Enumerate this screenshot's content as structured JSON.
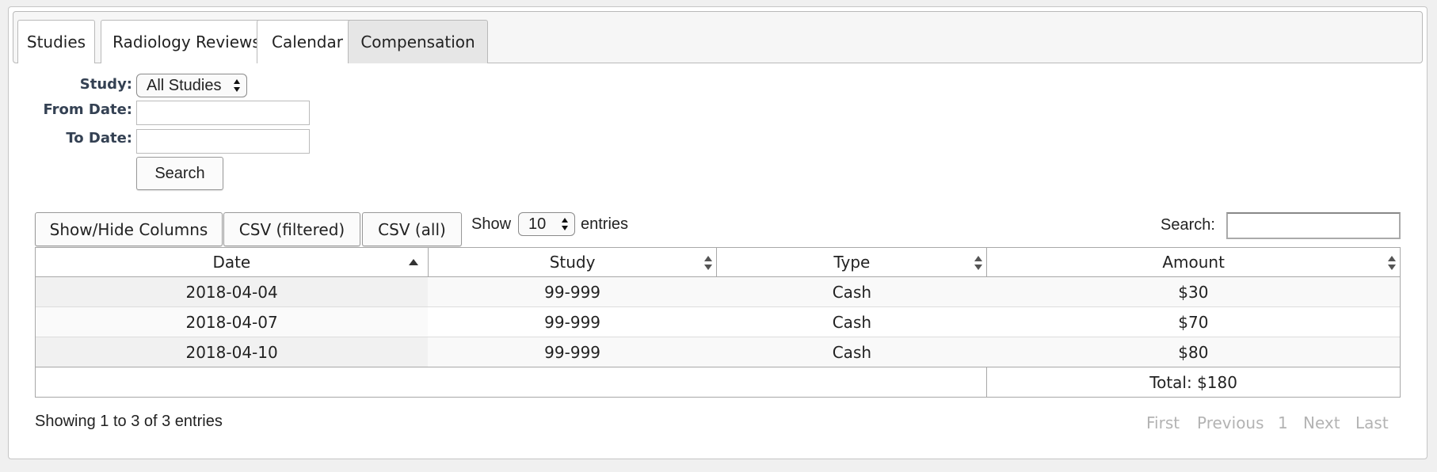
{
  "tabs": [
    {
      "label": "Studies"
    },
    {
      "label": "Radiology Reviews"
    },
    {
      "label": "Calendar"
    },
    {
      "label": "Compensation",
      "active": true
    }
  ],
  "filters": {
    "study_label": "Study:",
    "study_value": "All Studies",
    "from_label": "From Date:",
    "from_value": "",
    "to_label": "To Date:",
    "to_value": "",
    "search_button": "Search"
  },
  "toolbar": {
    "show_hide": "Show/Hide Columns",
    "csv_filtered": "CSV (filtered)",
    "csv_all": "CSV (all)",
    "show_label": "Show",
    "length_value": "10",
    "entries_label": "entries",
    "search_label": "Search:",
    "search_value": ""
  },
  "table": {
    "headers": [
      "Date",
      "Study",
      "Type",
      "Amount"
    ],
    "rows": [
      [
        "2018-04-04",
        "99-999",
        "Cash",
        "$30"
      ],
      [
        "2018-04-07",
        "99-999",
        "Cash",
        "$70"
      ],
      [
        "2018-04-10",
        "99-999",
        "Cash",
        "$80"
      ]
    ],
    "footer_total": "Total: $180"
  },
  "info": "Showing 1 to 3 of 3 entries",
  "pagination": {
    "first": "First",
    "previous": "Previous",
    "page": "1",
    "next": "Next",
    "last": "Last"
  },
  "icons": {
    "sort_asc": "sort-asc-icon",
    "sort_both": "sort-both-icon",
    "select_arrows": "select-arrows-icon"
  }
}
